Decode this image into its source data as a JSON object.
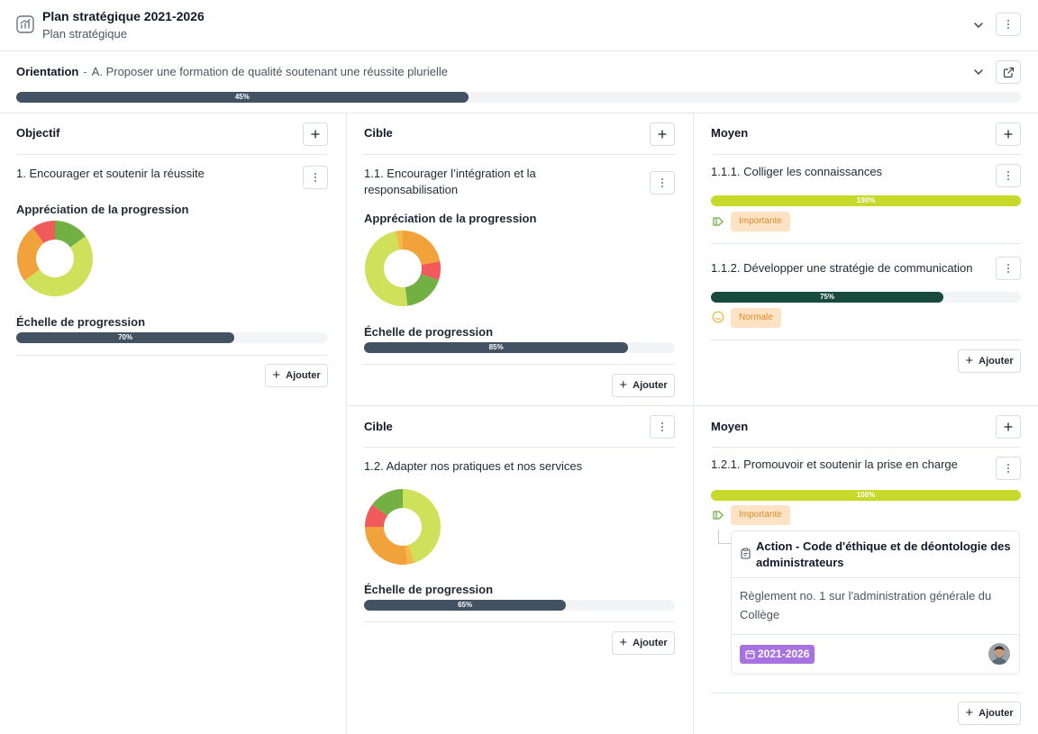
{
  "header": {
    "title": "Plan stratégique 2021-2026",
    "subtitle": "Plan stratégique",
    "icon": "chart-icon"
  },
  "orientation": {
    "label": "Orientation",
    "separator": "-",
    "value": "A. Proposer une formation de qualité soutenant une réussite plurielle",
    "progress": 45,
    "progress_label": "45%"
  },
  "common": {
    "add_label": "Ajouter",
    "appreciation_label": "Appréciation de la progression",
    "scale_label": "Échelle de progression"
  },
  "colors": {
    "red": "#f15a5a",
    "orange": "#f2a23a",
    "yellow_orange": "#f5b94a",
    "lime": "#cfe05a",
    "green": "#72b043",
    "bar_dark": "#425262",
    "bar_lime": "#c7d92b",
    "bar_green": "#184a3e",
    "badge_bg": "#fde3c4",
    "badge_text": "#d98a2a",
    "date_badge": "#a872e0"
  },
  "objectif": {
    "column_title": "Objectif",
    "item": "1. Encourager et soutenir la réussite",
    "donut": [
      {
        "name": "green",
        "value": 0.15
      },
      {
        "name": "lime",
        "value": 0.5
      },
      {
        "name": "orange",
        "value": 0.25
      },
      {
        "name": "red",
        "value": 0.1
      }
    ],
    "progress": 70,
    "progress_label": "70%"
  },
  "cible1": {
    "column_title": "Cible",
    "item": "1.1. Encourager l’intégration et la responsabilisation",
    "donut": [
      {
        "name": "orange",
        "value": 0.22
      },
      {
        "name": "red",
        "value": 0.08
      },
      {
        "name": "green",
        "value": 0.18
      },
      {
        "name": "lime",
        "value": 0.49
      },
      {
        "name": "yellow_orange",
        "value": 0.03
      }
    ],
    "progress": 85,
    "progress_label": "85%"
  },
  "cible2": {
    "column_title": "Cible",
    "item": "1.2. Adapter nos pratiques et nos services",
    "donut": [
      {
        "name": "lime",
        "value": 0.45
      },
      {
        "name": "yellow_orange",
        "value": 0.03
      },
      {
        "name": "orange",
        "value": 0.27
      },
      {
        "name": "red",
        "value": 0.1
      },
      {
        "name": "green",
        "value": 0.15
      }
    ],
    "progress": 65,
    "progress_label": "65%"
  },
  "moyen1": {
    "column_title": "Moyen",
    "items": [
      {
        "label": "1.1.1. Colliger les connaissances",
        "progress": 100,
        "progress_label": "100%",
        "priority": "Importante",
        "status_icon": "play-icon"
      },
      {
        "label": "1.1.2. Développer une stratégie de communication",
        "progress": 75,
        "progress_label": "75%",
        "priority": "Normale",
        "status_icon": "smiley-icon"
      }
    ]
  },
  "moyen2": {
    "column_title": "Moyen",
    "items": [
      {
        "label": "1.2.1. Promouvoir et soutenir la prise en charge",
        "progress": 100,
        "progress_label": "100%",
        "priority": "Importante",
        "status_icon": "play-icon"
      }
    ],
    "action": {
      "title": "Action - Code d'éthique et de déontologie des administrateurs",
      "description": "Règlement no. 1 sur l'administration générale du Collège",
      "period": "2021-2026"
    }
  }
}
